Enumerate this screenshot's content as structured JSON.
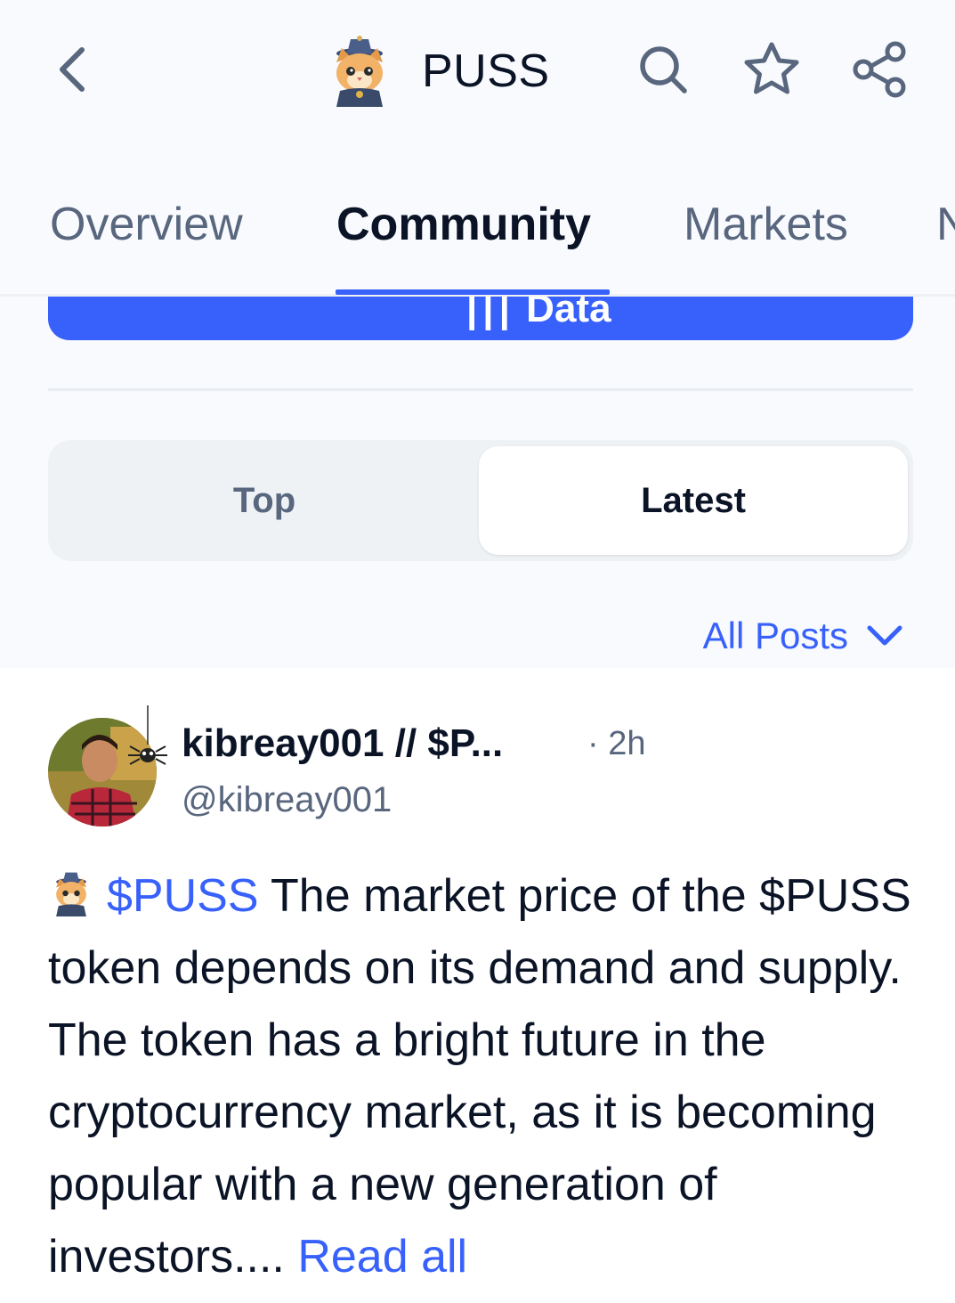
{
  "header": {
    "coin_name": "PUSS",
    "back_icon": "chevron-left-icon",
    "logo_icon": "cat-wizard-logo-icon",
    "search_icon": "search-icon",
    "star_icon": "star-icon",
    "share_icon": "share-icon"
  },
  "tabs": [
    {
      "label": "Overview"
    },
    {
      "label": "Community"
    },
    {
      "label": "Markets"
    },
    {
      "label": "N"
    }
  ],
  "active_tab": "Community",
  "data_button": {
    "label": "Data"
  },
  "segment": {
    "top_label": "Top",
    "latest_label": "Latest",
    "selected": "Latest"
  },
  "filter": {
    "label": "All Posts",
    "icon": "chevron-down-icon"
  },
  "post": {
    "author_name": "kibreay001 // $P...",
    "time": "· 2h",
    "handle": "@kibreay001",
    "cashtag": "$PUSS",
    "body": " The market price of the $PUSS token depends on its demand and supply. The token has a bright future in the cryptocurrency market, as it is becoming popular with a new generation of investors.... ",
    "read_all": "Read all"
  },
  "colors": {
    "accent": "#3861fb",
    "text_primary": "#0b1426",
    "text_secondary": "#58667e",
    "background_top": "#f8fafd",
    "segment_bg": "#eff2f5"
  }
}
